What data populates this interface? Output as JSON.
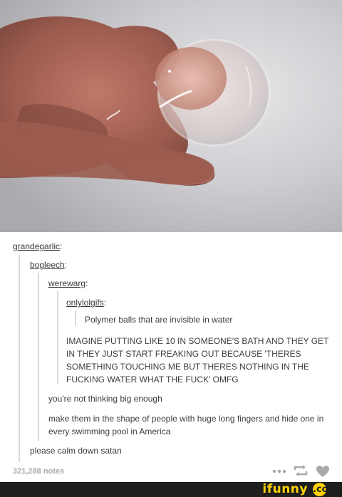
{
  "image": {
    "description_icon": "polymer-ball-in-hand-photo-icon"
  },
  "chain": {
    "user1": "grandegarlic",
    "user2": "bogleech",
    "user3": "werewarg",
    "user4": "onlylolgifs",
    "colon": ":",
    "quote_original": "Polymer balls that are invisible in water",
    "quote_werewarg": "IMAGINE PUTTING LIKE 10 IN SOMEONE'S BATH AND THEY GET IN THEY JUST START FREAKING OUT BECAUSE 'THERES SOMETHING TOUCHING ME BUT THERES NOTHING IN THE FUCKING WATER WHAT THE FUCK' OMFG",
    "reply_bogleech_1": "you're not thinking big enough",
    "reply_bogleech_2": "make them in the shape of people with huge long fingers and hide one in every swimming pool in America",
    "reply_grandegarlic": "please calm down satan"
  },
  "footer": {
    "notes": "321,288 notes",
    "icons": [
      "more-dots-icon",
      "reblog-icon",
      "heart-icon"
    ],
    "icon_color": "#a9a9a9"
  },
  "watermark": {
    "text": "ifunny",
    "mark": ".co",
    "brand_color": "#ffd200",
    "bar_color": "#1e1e1e"
  }
}
